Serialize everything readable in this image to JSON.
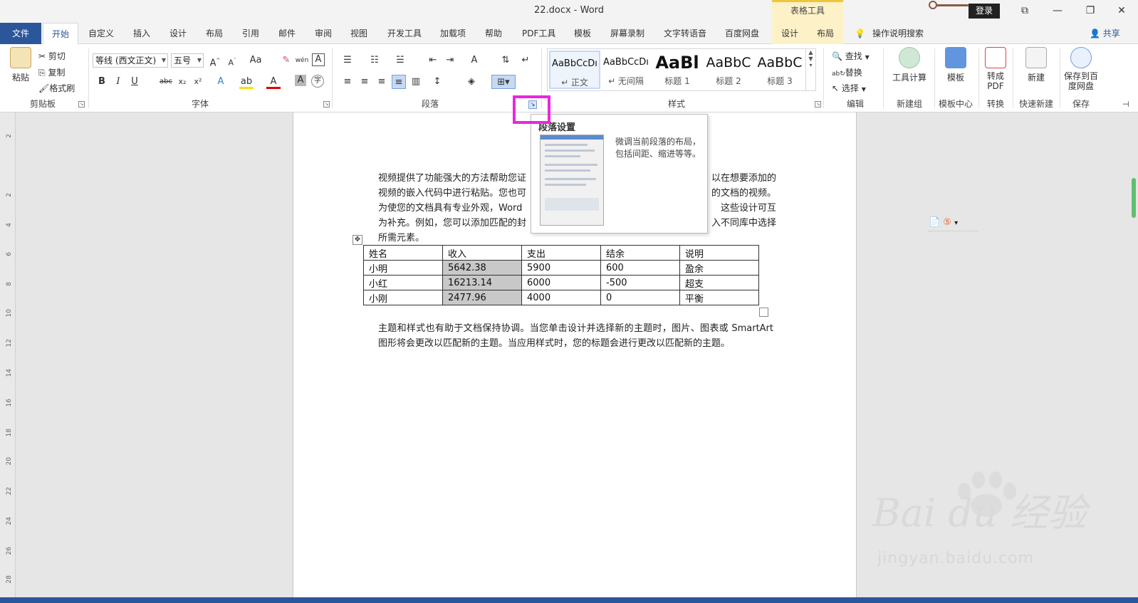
{
  "window": {
    "title": "22.docx  -  Word",
    "context_group": "表格工具",
    "login_label": "登录",
    "win_buttons": [
      "⧉",
      "—",
      "❐",
      "✕"
    ]
  },
  "tabs": {
    "file": "文件",
    "items": [
      "开始",
      "自定义",
      "插入",
      "设计",
      "布局",
      "引用",
      "邮件",
      "审阅",
      "视图",
      "开发工具",
      "加载项",
      "帮助",
      "PDF工具",
      "模板",
      "屏幕录制",
      "文字转语音",
      "百度网盘",
      "设计",
      "布局"
    ],
    "tell_me": "操作说明搜索",
    "share": "共享"
  },
  "clipboard": {
    "paste": "粘贴",
    "cut": "剪切",
    "copy": "复制",
    "format_painter": "格式刷",
    "label": "剪贴板"
  },
  "font": {
    "name": "等线 (西文正文)",
    "size": "五号",
    "label": "字体",
    "case_label": "Aa",
    "phonetic": "wén",
    "bold": "B",
    "italic": "I",
    "underline": "U",
    "strike": "abc",
    "subscript": "x₂",
    "superscript": "x²"
  },
  "paragraph": {
    "label": "段落"
  },
  "styles": {
    "label": "样式",
    "items": [
      {
        "sample": "AaBbCcDı",
        "name": "↵ 正文"
      },
      {
        "sample": "AaBbCcDı",
        "name": "↵ 无间隔"
      },
      {
        "sample": "AaBl",
        "name": "标题 1"
      },
      {
        "sample": "AaBbC",
        "name": "标题 2"
      },
      {
        "sample": "AaBbC",
        "name": "标题 3"
      }
    ]
  },
  "editing": {
    "find": "查找",
    "replace": "替换",
    "select": "选择",
    "label": "编辑"
  },
  "extra_groups": [
    {
      "button": "工具计算",
      "label": "新建组"
    },
    {
      "button": "模板",
      "label": "模板中心"
    },
    {
      "button": "转成PDF",
      "label": "转换"
    },
    {
      "button": "新建",
      "label": "快速新建"
    },
    {
      "button": "保存到百度网盘",
      "label": "保存"
    }
  ],
  "tooltip": {
    "title": "段落设置",
    "description": "微调当前段落的布局，包括间距、缩进等等。"
  },
  "document": {
    "paragraph1": [
      "视频提供了功能强大的方法帮助您证",
      "视频的嵌入代码中进行粘贴。您也可",
      "为使您的文档具有专业外观，Word",
      "为补充。例如，您可以添加匹配的封",
      "所需元素。"
    ],
    "paragraph1_right": [
      "以在想要添加的",
      "的文档的视频。",
      "这些设计可互",
      "入不同库中选择"
    ],
    "table": {
      "headers": [
        "姓名",
        "收入",
        "支出",
        "结余",
        "说明"
      ],
      "rows": [
        [
          "小明",
          "5642.38",
          "5900",
          "600",
          "盈余"
        ],
        [
          "小红",
          "16213.14",
          "6000",
          "-500",
          "超支"
        ],
        [
          "小刚",
          "2477.96",
          "4000",
          "0",
          "平衡"
        ]
      ]
    },
    "paragraph2": "主题和样式也有助于文档保持协调。当您单击设计并选择新的主题时，图片、图表或 SmartArt 图形将会更改以匹配新的主题。当应用样式时，您的标题会进行更改以匹配新的主题。"
  },
  "ruler_numbers": [
    "2",
    "2",
    "4",
    "6",
    "8",
    "10",
    "12",
    "14",
    "16",
    "18",
    "20",
    "22",
    "24",
    "26",
    "28"
  ],
  "watermark": {
    "brand": "Bai du 经验",
    "url": "jingyan.baidu.com"
  },
  "colors": {
    "accent": "#2b579a",
    "highlight": "#ea26df",
    "context": "#fdf1c8"
  }
}
